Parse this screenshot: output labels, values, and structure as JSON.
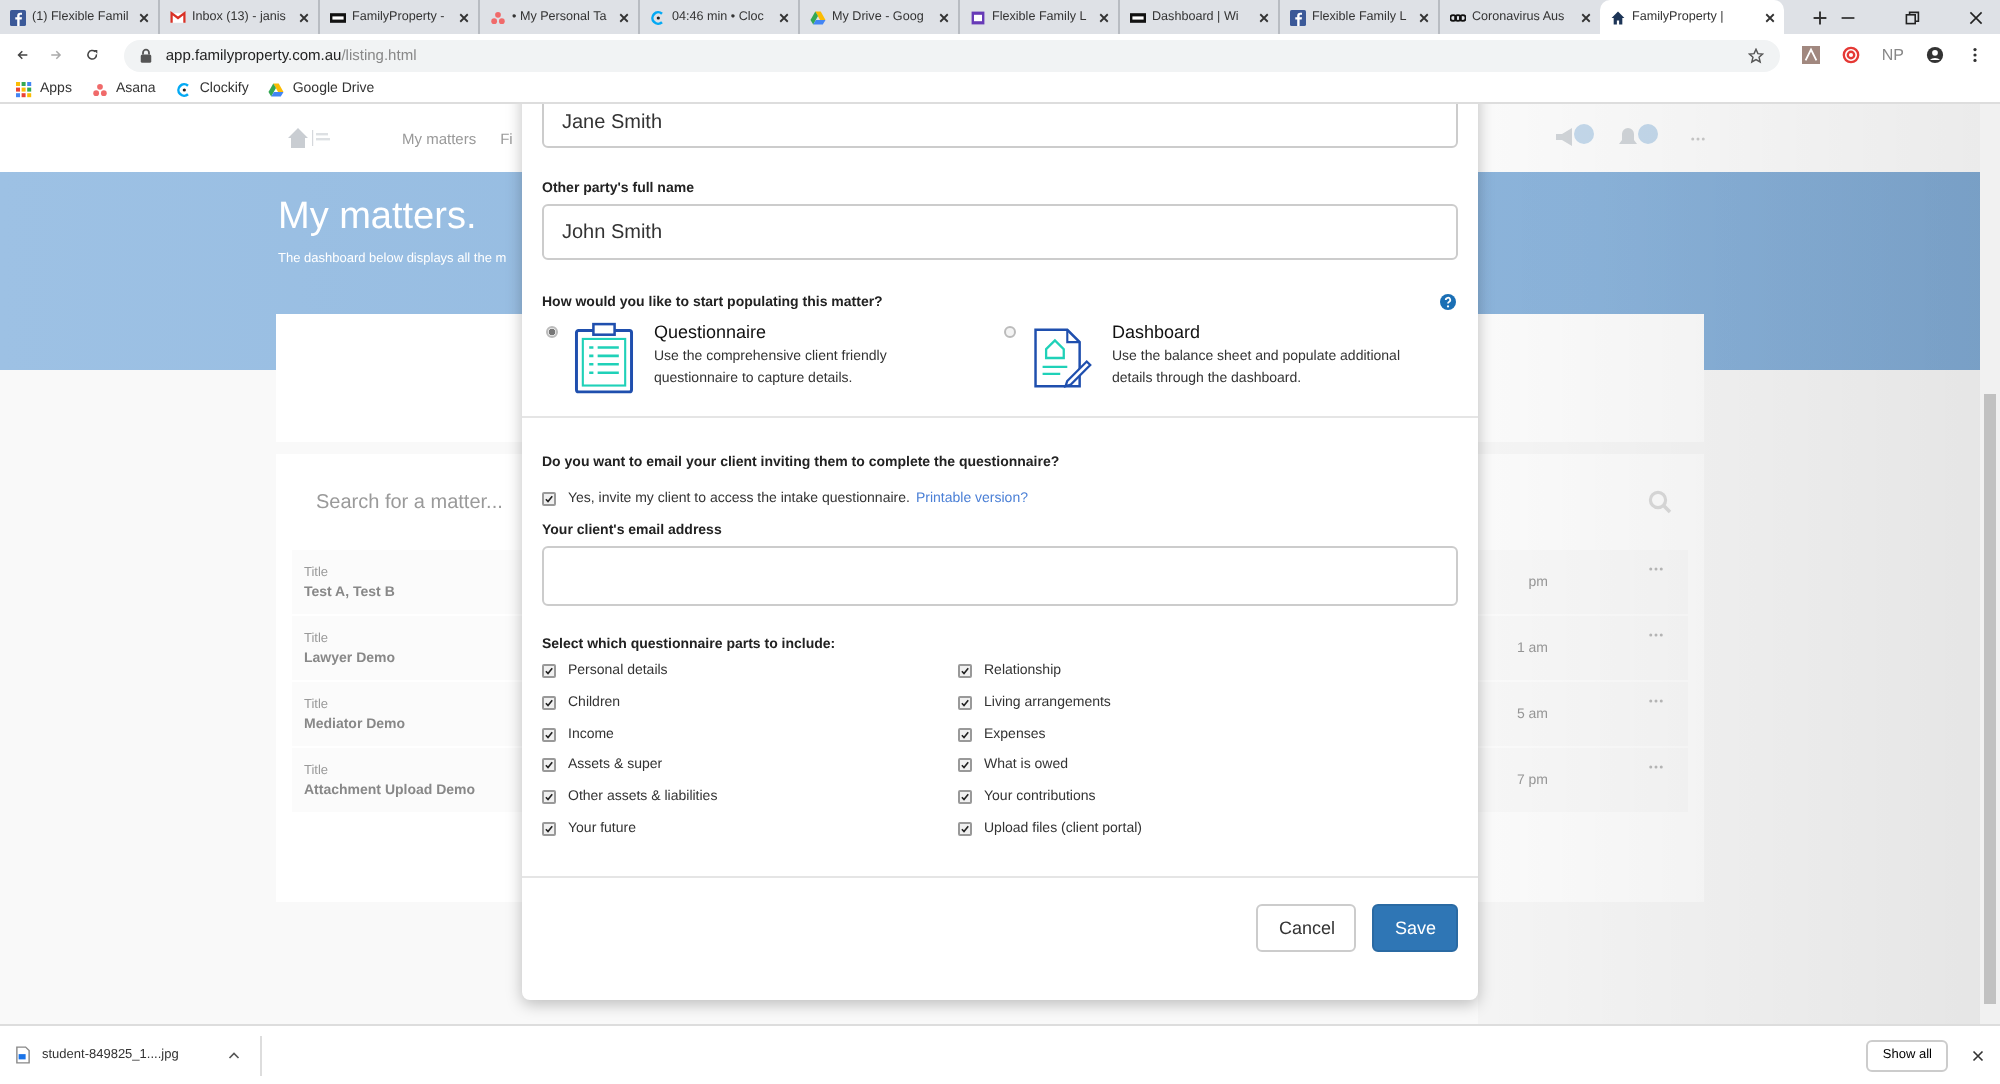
{
  "browser": {
    "tabs": [
      {
        "title": "(1) Flexible Famil",
        "kind": "facebook",
        "selected": false
      },
      {
        "title": "Inbox (13) - janis",
        "kind": "gmail",
        "selected": false
      },
      {
        "title": "FamilyProperty -",
        "kind": "wix",
        "selected": false
      },
      {
        "title": "• My Personal Ta",
        "kind": "asana",
        "selected": false
      },
      {
        "title": "04:46 min • Cloc",
        "kind": "clockify",
        "selected": false
      },
      {
        "title": "My Drive - Goog",
        "kind": "drive",
        "selected": false
      },
      {
        "title": "Flexible Family L",
        "kind": "form",
        "selected": false
      },
      {
        "title": "Dashboard | Wi",
        "kind": "wix",
        "selected": false
      },
      {
        "title": "Flexible Family L",
        "kind": "facebook",
        "selected": false
      },
      {
        "title": "Coronavirus Aus",
        "kind": "abc",
        "selected": false
      },
      {
        "title": "FamilyProperty |",
        "kind": "house",
        "selected": true
      }
    ],
    "address": {
      "host": "app.familyproperty.com.au",
      "path": "/listing.html"
    },
    "bookmarks": [
      {
        "label": "Apps",
        "kind": "apps"
      },
      {
        "label": "Asana",
        "kind": "asana"
      },
      {
        "label": "Clockify",
        "kind": "clockify"
      },
      {
        "label": "Google Drive",
        "kind": "drive"
      }
    ],
    "profile_initials": "NP"
  },
  "page": {
    "nav": [
      "My matters",
      "Fi"
    ],
    "title": "My matters.",
    "subtitle": "The dashboard below displays all the m",
    "search": {
      "placeholder": "Search for a matter..."
    },
    "matters": [
      {
        "label": "Title",
        "name": "Test A, Test B",
        "time": "pm"
      },
      {
        "label": "Title",
        "name": "Lawyer Demo",
        "time": "1 am"
      },
      {
        "label": "Title",
        "name": "Mediator Demo",
        "time": "5 am"
      },
      {
        "label": "Title",
        "name": "Attachment Upload Demo",
        "time": "7 pm"
      }
    ]
  },
  "dialog": {
    "first_field": {
      "value": "Jane Smith"
    },
    "other_party": {
      "label": "Other party's full name",
      "value": "John Smith"
    },
    "populate": {
      "question": "How would you like to start populating this matter?",
      "options": [
        {
          "kind": "questionnaire",
          "title": "Questionnaire",
          "description": "Use the comprehensive client friendly questionnaire to capture details.",
          "selected": true
        },
        {
          "kind": "dashboard",
          "title": "Dashboard",
          "description": "Use the balance sheet and populate additional details through the dashboard.",
          "selected": false
        }
      ]
    },
    "email": {
      "question": "Do you want to email your client inviting them to complete the questionnaire?",
      "invite": {
        "label": "Yes, invite my client to access the intake questionnaire.",
        "link": "Printable version?",
        "checked": true
      },
      "address": {
        "label": "Your client's email address"
      }
    },
    "parts": {
      "label": "Select which questionnaire parts to include:",
      "items": [
        {
          "label": "Personal details",
          "checked": true
        },
        {
          "label": "Relationship",
          "checked": true
        },
        {
          "label": "Children",
          "checked": true
        },
        {
          "label": "Living arrangements",
          "checked": true
        },
        {
          "label": "Income",
          "checked": true
        },
        {
          "label": "Expenses",
          "checked": true
        },
        {
          "label": "Assets & super",
          "checked": true
        },
        {
          "label": "What is owed",
          "checked": true
        },
        {
          "label": "Other assets & liabilities",
          "checked": true
        },
        {
          "label": "Your contributions",
          "checked": true
        },
        {
          "label": "Your future",
          "checked": true
        },
        {
          "label": "Upload files (client portal)",
          "checked": true
        }
      ]
    },
    "buttons": [
      {
        "label": "Cancel",
        "kind": "secondary"
      },
      {
        "label": "Save",
        "kind": "primary"
      }
    ]
  },
  "downloads": {
    "file": "student-849825_1....jpg",
    "show_all": "Show all"
  }
}
